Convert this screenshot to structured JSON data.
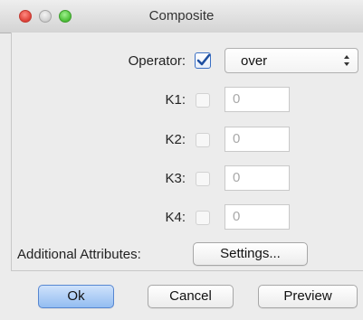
{
  "window": {
    "title": "Composite"
  },
  "operator": {
    "label": "Operator:",
    "checked": true,
    "value": "over"
  },
  "k_rows": [
    {
      "label": "K1:",
      "value": "0"
    },
    {
      "label": "K2:",
      "value": "0"
    },
    {
      "label": "K3:",
      "value": "0"
    },
    {
      "label": "K4:",
      "value": "0"
    }
  ],
  "attributes": {
    "label": "Additional Attributes:",
    "button": "Settings..."
  },
  "buttons": {
    "ok": "Ok",
    "cancel": "Cancel",
    "preview": "Preview"
  },
  "colors": {
    "accent": "#3a6fc4",
    "default_button": "#93bdf1"
  }
}
